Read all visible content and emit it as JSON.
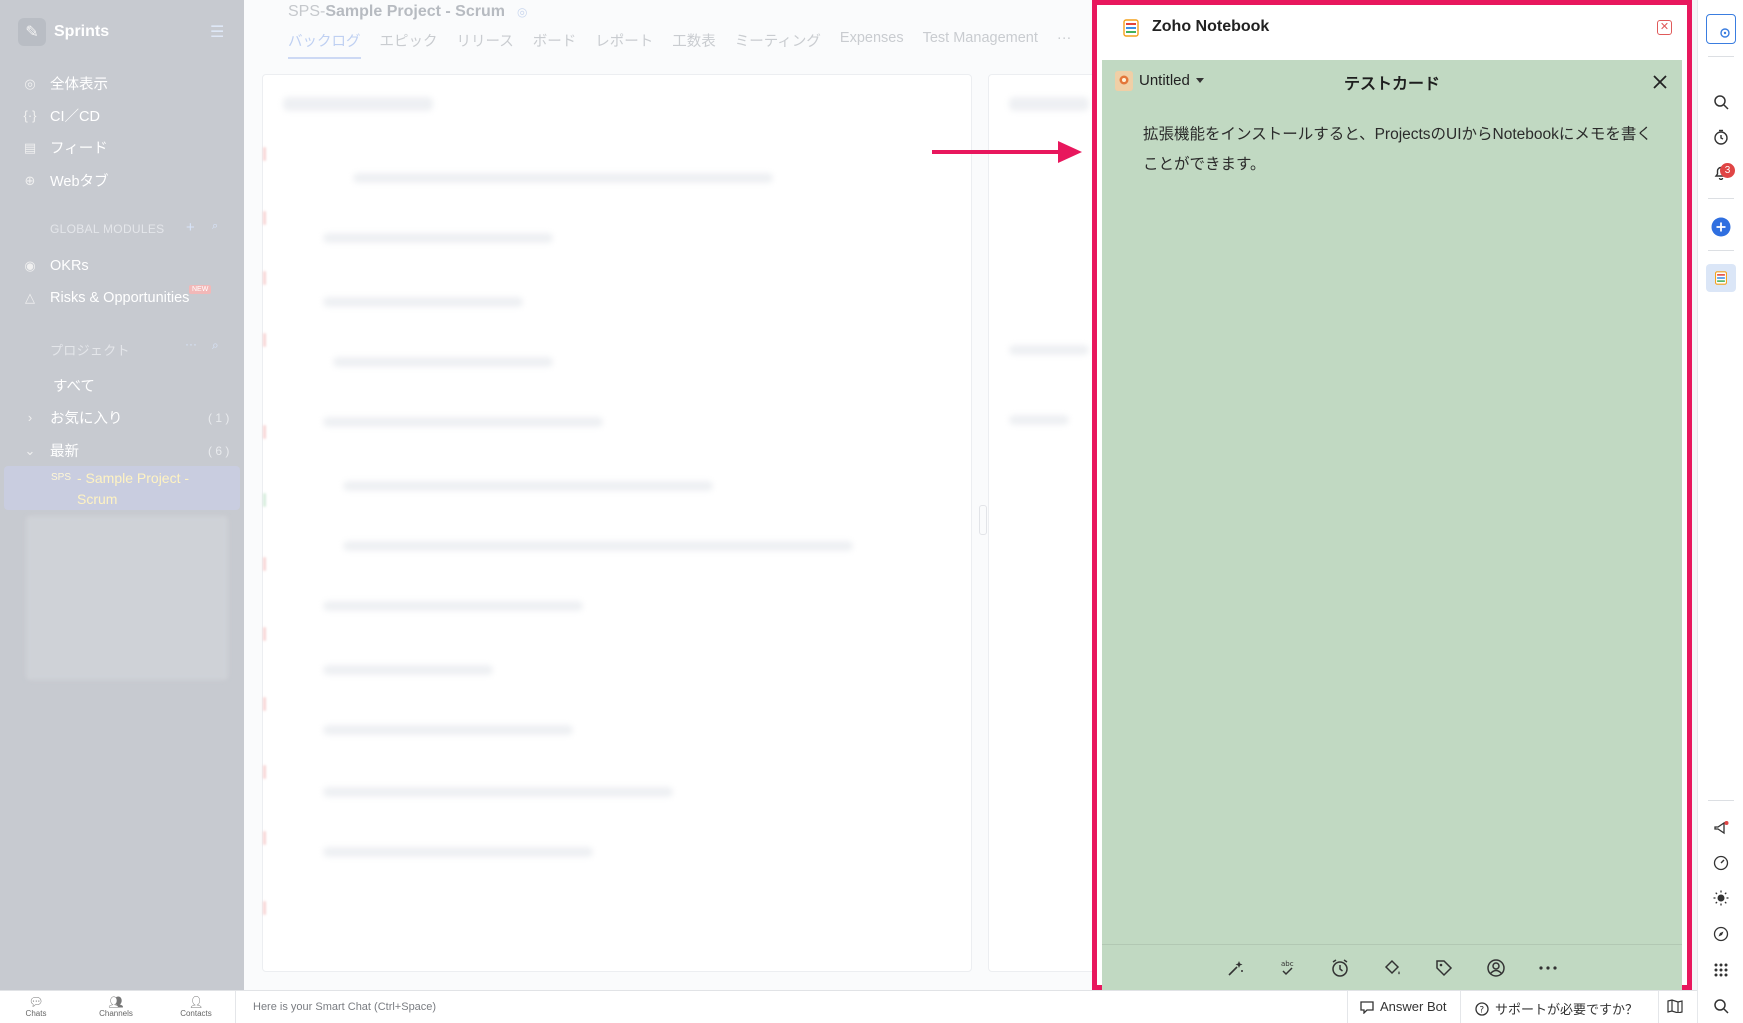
{
  "sidebar": {
    "app_name": "Sprints",
    "nav": [
      {
        "label": "全体表示",
        "icon": "overview-icon"
      },
      {
        "label": "CI／CD",
        "icon": "cicd-icon"
      },
      {
        "label": "フィード",
        "icon": "feed-icon"
      },
      {
        "label": "Webタブ",
        "icon": "globe-icon"
      }
    ],
    "global_modules_label": "GLOBAL MODULES",
    "modules": [
      {
        "label": "OKRs",
        "icon": "target-icon"
      },
      {
        "label": "Risks & Opportunities",
        "icon": "risk-icon",
        "badge": "NEW"
      }
    ],
    "projects_label": "プロジェクト",
    "project_groups": [
      {
        "label": "すべて",
        "count": ""
      },
      {
        "label": "お気に入り",
        "count": "( 1 )"
      },
      {
        "label": "最新",
        "count": "( 6 )"
      }
    ],
    "active_project": {
      "code": "SPS",
      "name": "- Sample Project - Scrum"
    }
  },
  "main": {
    "project_prefix": "SPS-",
    "project_name": "Sample Project - Scrum",
    "tabs": [
      "バックログ",
      "エピック",
      "リリース",
      "ボード",
      "レポート",
      "工数表",
      "ミーティング",
      "Expenses",
      "Test Management",
      "···"
    ],
    "active_tab": 0
  },
  "notebook": {
    "title": "Zoho Notebook",
    "notebook_name": "Untitled",
    "card_title": "テストカード",
    "card_body": "拡張機能をインストールすると、ProjectsのUIからNotebookにメモを書くことができます。",
    "background_color": "#c1d9c2",
    "frame_color": "#e8175d",
    "toolbar": [
      "ai-sparkle-icon",
      "spellcheck-icon",
      "reminder-icon",
      "fill-color-icon",
      "tag-icon",
      "share-user-icon",
      "more-icon"
    ]
  },
  "rail": {
    "notification_count": "3"
  },
  "bottom_bar": {
    "chats": "Chats",
    "channels": "Channels",
    "contacts": "Contacts",
    "smart_chat_placeholder": "Here is your Smart Chat (Ctrl+Space)",
    "answer_bot": "Answer Bot",
    "help": "サポートが必要ですか？"
  }
}
